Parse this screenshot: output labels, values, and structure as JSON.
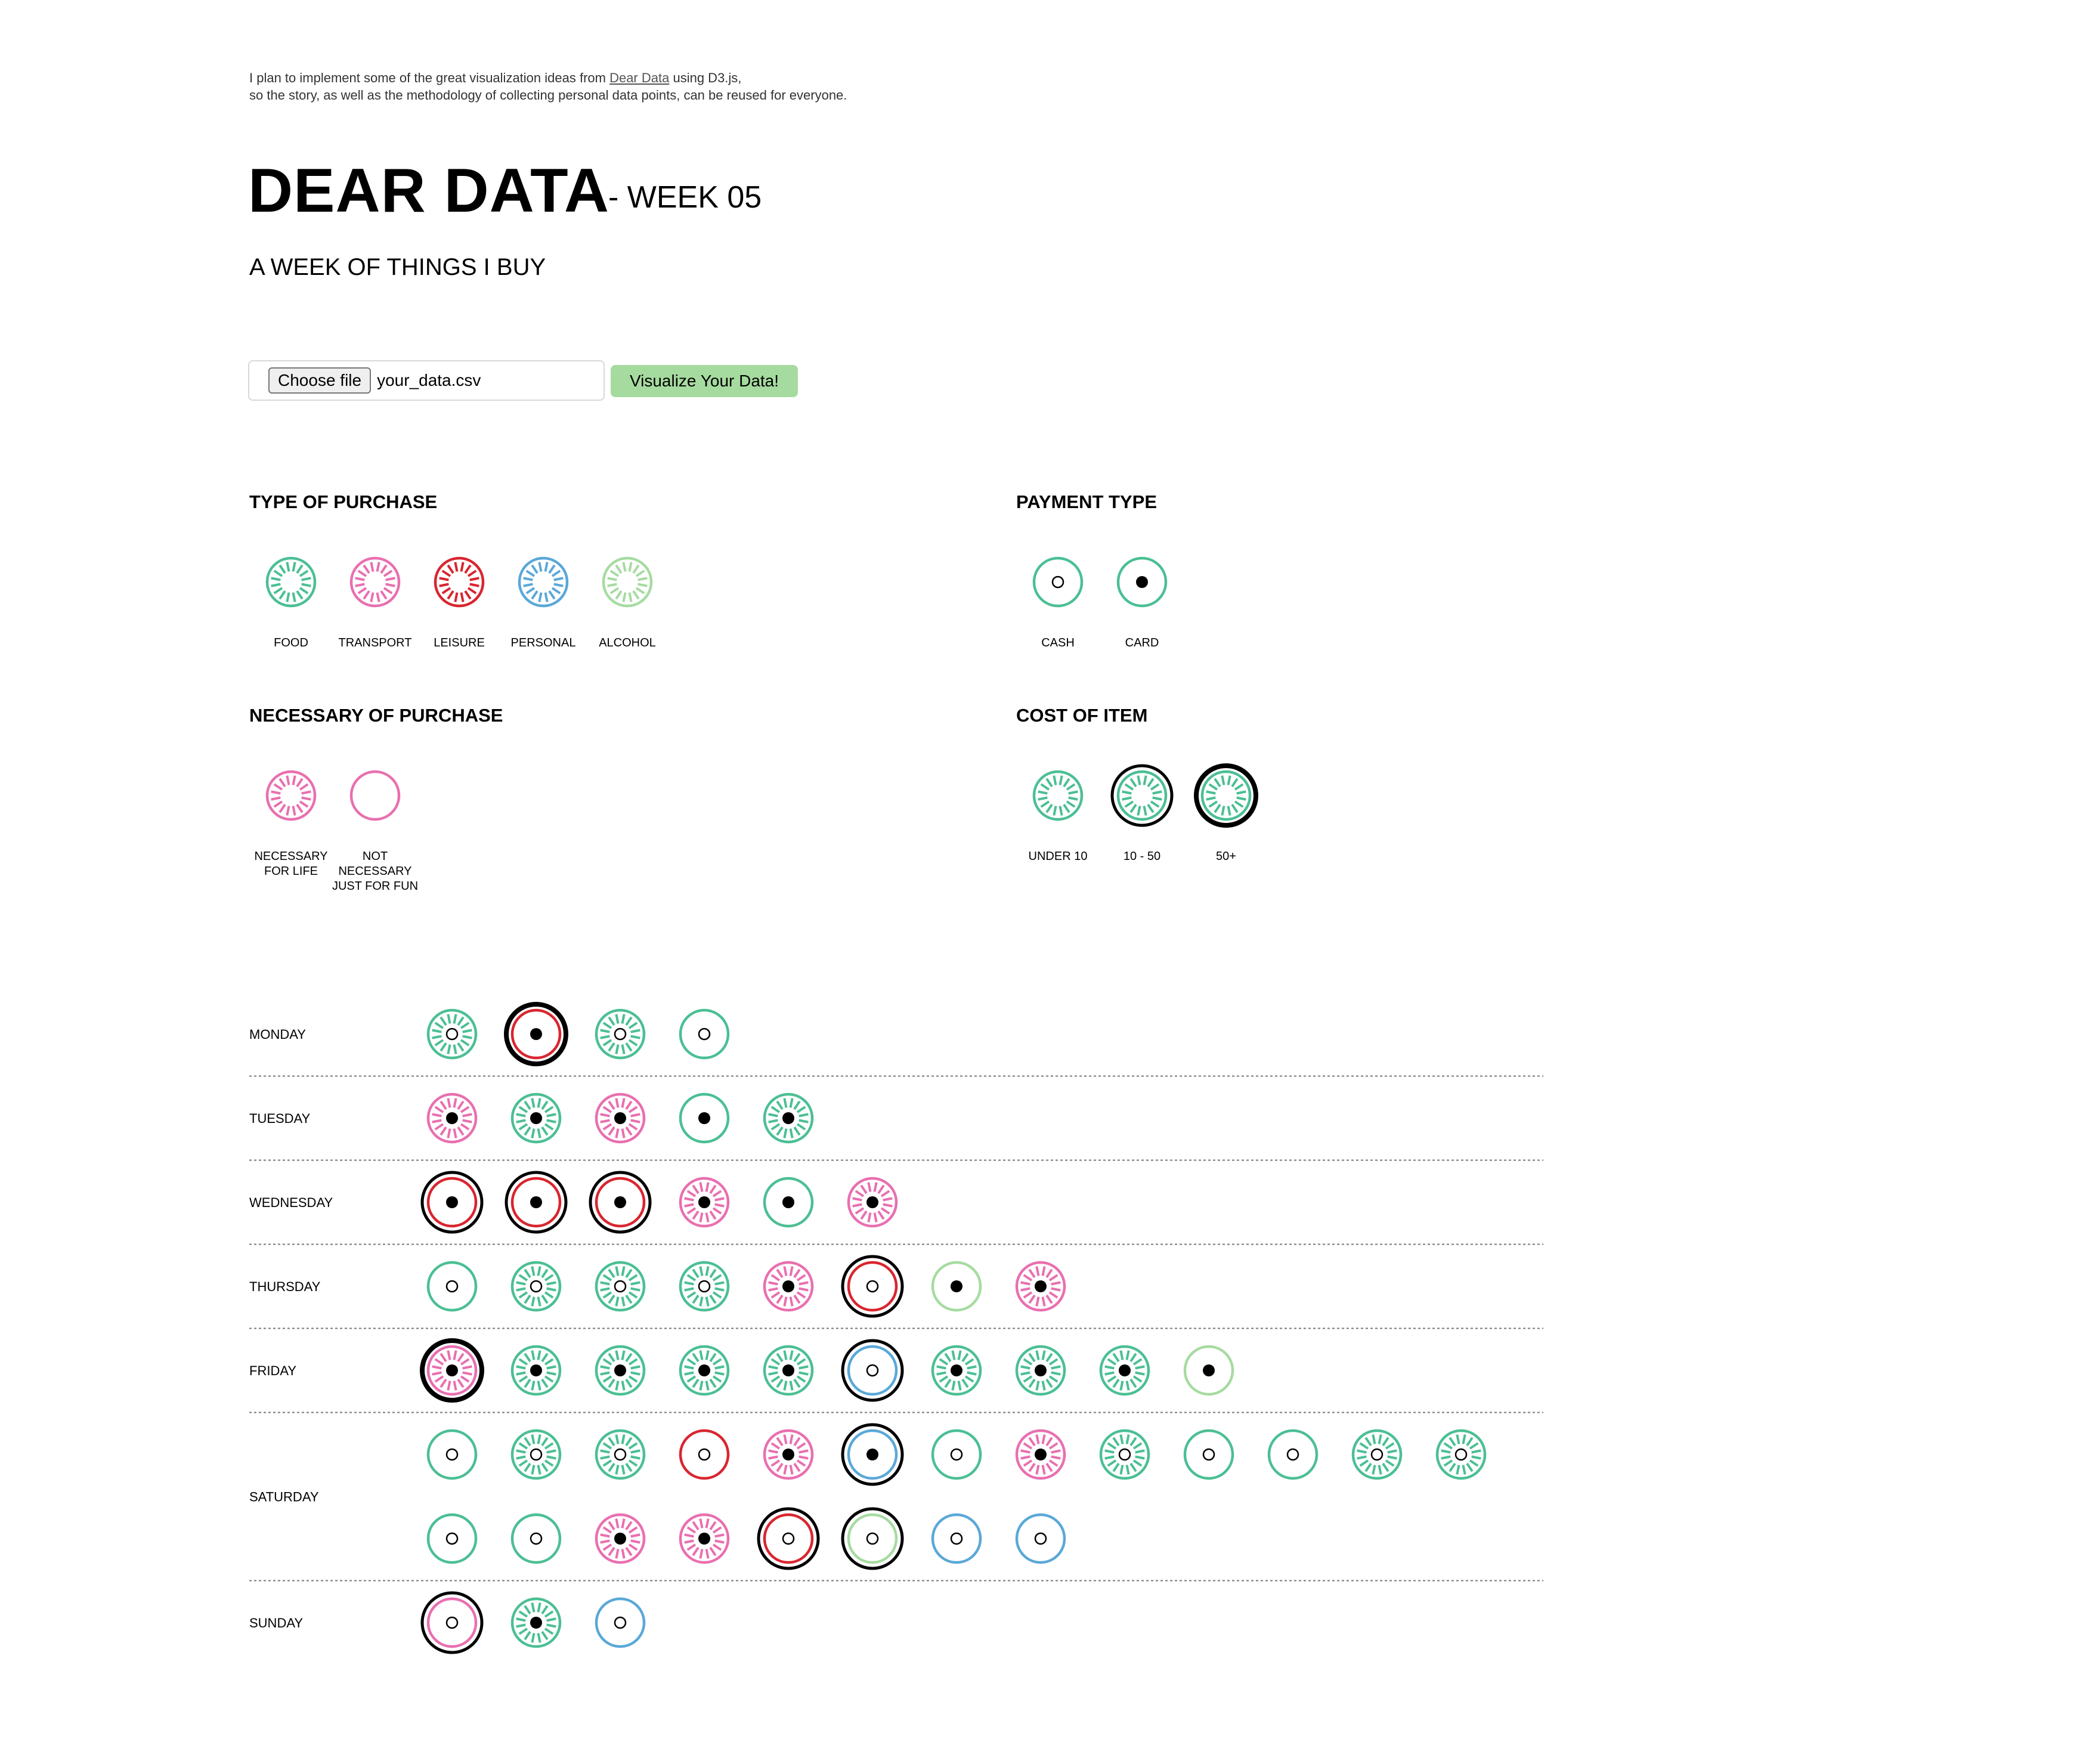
{
  "intro": {
    "line1_pre": "I plan to implement some of the great visualization ideas from ",
    "link_text": "Dear Data",
    "line1_post": " using D3.js,",
    "line2": "so the story, as well as the methodology of collecting personal data points, can be reused for everyone."
  },
  "header": {
    "title": "DEAR DATA",
    "week": "- WEEK 05",
    "subtitle": "A WEEK OF THINGS I BUY"
  },
  "upload": {
    "choose_label": "Choose file",
    "file_name": "your_data.csv",
    "visualize_label": "Visualize Your Data!"
  },
  "colors": {
    "food": "#4bbf94",
    "transport": "#e96fb0",
    "leisure": "#d9252f",
    "personal": "#5aa8d8",
    "alcohol": "#a6dba0"
  },
  "legend": {
    "type": {
      "heading": "TYPE OF PURCHASE",
      "items": [
        {
          "label": "FOOD",
          "cat": "food"
        },
        {
          "label": "TRANSPORT",
          "cat": "transport"
        },
        {
          "label": "LEISURE",
          "cat": "leisure"
        },
        {
          "label": "PERSONAL",
          "cat": "personal"
        },
        {
          "label": "ALCOHOL",
          "cat": "alcohol"
        }
      ]
    },
    "payment": {
      "heading": "PAYMENT TYPE",
      "items": [
        {
          "label": "CASH",
          "pay": "cash"
        },
        {
          "label": "CARD",
          "pay": "card"
        }
      ]
    },
    "necessary": {
      "heading": "NECESSARY OF PURCHASE",
      "items": [
        {
          "lines": [
            "NECESSARY",
            "FOR LIFE"
          ],
          "nec": true
        },
        {
          "lines": [
            "NOT",
            "NECESSARY",
            "JUST FOR FUN"
          ],
          "nec": false
        }
      ]
    },
    "cost": {
      "heading": "COST OF ITEM",
      "items": [
        {
          "label": "UNDER 10",
          "cost": "under10"
        },
        {
          "label": "10 - 50",
          "cost": "10-50"
        },
        {
          "label": "50+",
          "cost": "50+"
        }
      ]
    }
  },
  "days": [
    {
      "label": "MONDAY",
      "items": [
        {
          "cat": "food",
          "nec": true,
          "pay": "cash",
          "cost": "under10"
        },
        {
          "cat": "leisure",
          "nec": false,
          "pay": "card",
          "cost": "50+"
        },
        {
          "cat": "food",
          "nec": true,
          "pay": "cash",
          "cost": "under10"
        },
        {
          "cat": "food",
          "nec": false,
          "pay": "cash",
          "cost": "under10"
        }
      ]
    },
    {
      "label": "TUESDAY",
      "items": [
        {
          "cat": "transport",
          "nec": true,
          "pay": "card",
          "cost": "under10"
        },
        {
          "cat": "food",
          "nec": true,
          "pay": "card",
          "cost": "under10"
        },
        {
          "cat": "transport",
          "nec": true,
          "pay": "card",
          "cost": "under10"
        },
        {
          "cat": "food",
          "nec": false,
          "pay": "card",
          "cost": "under10"
        },
        {
          "cat": "food",
          "nec": true,
          "pay": "card",
          "cost": "under10"
        }
      ]
    },
    {
      "label": "WEDNESDAY",
      "items": [
        {
          "cat": "leisure",
          "nec": false,
          "pay": "card",
          "cost": "10-50"
        },
        {
          "cat": "leisure",
          "nec": false,
          "pay": "card",
          "cost": "10-50"
        },
        {
          "cat": "leisure",
          "nec": false,
          "pay": "card",
          "cost": "10-50"
        },
        {
          "cat": "transport",
          "nec": true,
          "pay": "card",
          "cost": "under10"
        },
        {
          "cat": "food",
          "nec": false,
          "pay": "card",
          "cost": "under10"
        },
        {
          "cat": "transport",
          "nec": true,
          "pay": "card",
          "cost": "under10"
        }
      ]
    },
    {
      "label": "THURSDAY",
      "items": [
        {
          "cat": "food",
          "nec": false,
          "pay": "cash",
          "cost": "under10"
        },
        {
          "cat": "food",
          "nec": true,
          "pay": "cash",
          "cost": "under10"
        },
        {
          "cat": "food",
          "nec": true,
          "pay": "cash",
          "cost": "under10"
        },
        {
          "cat": "food",
          "nec": true,
          "pay": "cash",
          "cost": "under10"
        },
        {
          "cat": "transport",
          "nec": true,
          "pay": "card",
          "cost": "under10"
        },
        {
          "cat": "leisure",
          "nec": false,
          "pay": "cash",
          "cost": "10-50"
        },
        {
          "cat": "alcohol",
          "nec": false,
          "pay": "card",
          "cost": "under10"
        },
        {
          "cat": "transport",
          "nec": true,
          "pay": "card",
          "cost": "under10"
        }
      ]
    },
    {
      "label": "FRIDAY",
      "items": [
        {
          "cat": "transport",
          "nec": true,
          "pay": "card",
          "cost": "50+"
        },
        {
          "cat": "food",
          "nec": true,
          "pay": "card",
          "cost": "under10"
        },
        {
          "cat": "food",
          "nec": true,
          "pay": "card",
          "cost": "under10"
        },
        {
          "cat": "food",
          "nec": true,
          "pay": "card",
          "cost": "under10"
        },
        {
          "cat": "food",
          "nec": true,
          "pay": "card",
          "cost": "under10"
        },
        {
          "cat": "personal",
          "nec": false,
          "pay": "cash",
          "cost": "10-50"
        },
        {
          "cat": "food",
          "nec": true,
          "pay": "card",
          "cost": "under10"
        },
        {
          "cat": "food",
          "nec": true,
          "pay": "card",
          "cost": "under10"
        },
        {
          "cat": "food",
          "nec": true,
          "pay": "card",
          "cost": "under10"
        },
        {
          "cat": "alcohol",
          "nec": false,
          "pay": "card",
          "cost": "under10"
        }
      ]
    },
    {
      "label": "SATURDAY",
      "items": [
        {
          "cat": "food",
          "nec": false,
          "pay": "cash",
          "cost": "under10"
        },
        {
          "cat": "food",
          "nec": true,
          "pay": "cash",
          "cost": "under10"
        },
        {
          "cat": "food",
          "nec": true,
          "pay": "cash",
          "cost": "under10"
        },
        {
          "cat": "leisure",
          "nec": false,
          "pay": "cash",
          "cost": "under10"
        },
        {
          "cat": "transport",
          "nec": true,
          "pay": "card",
          "cost": "under10"
        },
        {
          "cat": "personal",
          "nec": false,
          "pay": "card",
          "cost": "10-50"
        },
        {
          "cat": "food",
          "nec": false,
          "pay": "cash",
          "cost": "under10"
        },
        {
          "cat": "transport",
          "nec": true,
          "pay": "card",
          "cost": "under10"
        },
        {
          "cat": "food",
          "nec": true,
          "pay": "cash",
          "cost": "under10"
        },
        {
          "cat": "food",
          "nec": false,
          "pay": "cash",
          "cost": "under10"
        },
        {
          "cat": "food",
          "nec": false,
          "pay": "cash",
          "cost": "under10"
        },
        {
          "cat": "food",
          "nec": true,
          "pay": "cash",
          "cost": "under10"
        },
        {
          "cat": "food",
          "nec": true,
          "pay": "cash",
          "cost": "under10"
        },
        {
          "cat": "food",
          "nec": false,
          "pay": "cash",
          "cost": "under10"
        },
        {
          "cat": "food",
          "nec": false,
          "pay": "cash",
          "cost": "under10"
        },
        {
          "cat": "transport",
          "nec": true,
          "pay": "card",
          "cost": "under10"
        },
        {
          "cat": "transport",
          "nec": true,
          "pay": "card",
          "cost": "under10"
        },
        {
          "cat": "leisure",
          "nec": false,
          "pay": "cash",
          "cost": "10-50"
        },
        {
          "cat": "alcohol",
          "nec": false,
          "pay": "cash",
          "cost": "10-50"
        },
        {
          "cat": "personal",
          "nec": false,
          "pay": "cash",
          "cost": "under10"
        },
        {
          "cat": "personal",
          "nec": false,
          "pay": "cash",
          "cost": "under10"
        }
      ]
    },
    {
      "label": "SUNDAY",
      "items": [
        {
          "cat": "transport",
          "nec": false,
          "pay": "cash",
          "cost": "10-50"
        },
        {
          "cat": "food",
          "nec": true,
          "pay": "card",
          "cost": "under10"
        },
        {
          "cat": "personal",
          "nec": false,
          "pay": "cash",
          "cost": "under10"
        }
      ]
    }
  ]
}
